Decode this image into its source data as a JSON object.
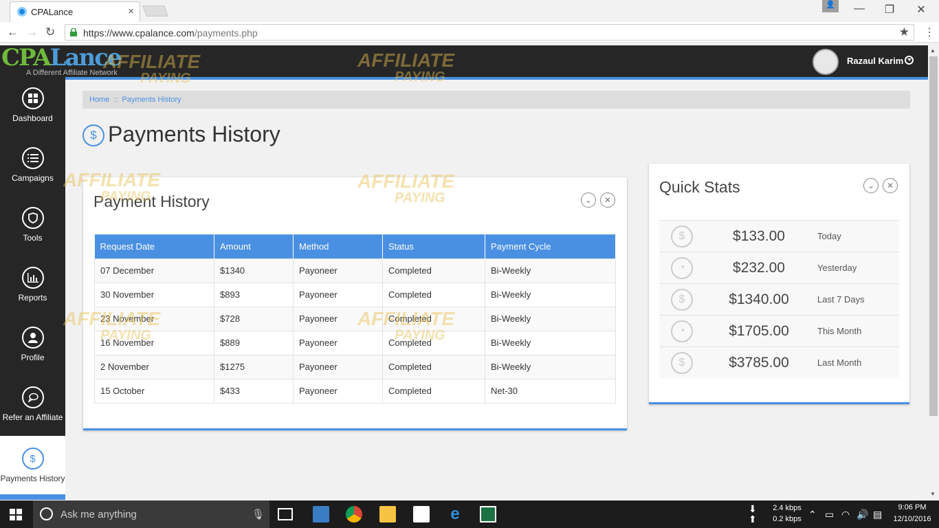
{
  "browser": {
    "tab_title": "CPALance",
    "tab_close": "×",
    "url_host": "https://www.cpalance.com",
    "url_path": "/payments.php",
    "window_controls": {
      "minimize": "—",
      "restore": "❐",
      "close": "✕"
    },
    "nav": {
      "back": "←",
      "forward": "→",
      "reload": "↻"
    },
    "bookmark_icon": "★",
    "menu_icon": "⋮"
  },
  "site": {
    "logo_part1": "CPA",
    "logo_part2": "Lance",
    "logo_tagline": "A Different Affiliate Network",
    "user_name": "Razaul Karim"
  },
  "watermark": {
    "line1": "AFFILIATE",
    "line2": "PAYING"
  },
  "sidebar": {
    "items": [
      {
        "label": "Dashboard",
        "icon": "grid-icon"
      },
      {
        "label": "Campaigns",
        "icon": "list-icon"
      },
      {
        "label": "Tools",
        "icon": "shield-icon"
      },
      {
        "label": "Reports",
        "icon": "bar-chart-icon"
      },
      {
        "label": "Profile",
        "icon": "user-icon"
      },
      {
        "label": "Refer an Affiliate",
        "icon": "chat-icon"
      }
    ],
    "active": {
      "label": "Payments History",
      "icon": "dollar-icon",
      "glyph": "$"
    }
  },
  "breadcrumb": {
    "home": "Home",
    "separator": "::",
    "current": "Payments History"
  },
  "page": {
    "title": "Payments History",
    "icon_glyph": "$"
  },
  "history_panel": {
    "title": "Payment History",
    "columns": [
      "Request Date",
      "Amount",
      "Method",
      "Status",
      "Payment Cycle"
    ],
    "rows": [
      [
        "07 December",
        "$1340",
        "Payoneer",
        "Completed",
        "Bi-Weekly"
      ],
      [
        "30 November",
        "$893",
        "Payoneer",
        "Completed",
        "Bi-Weekly"
      ],
      [
        "23 November",
        "$728",
        "Payoneer",
        "Completed",
        "Bi-Weekly"
      ],
      [
        "16 November",
        "$889",
        "Payoneer",
        "Completed",
        "Bi-Weekly"
      ],
      [
        "2 November",
        "$1275",
        "Payoneer",
        "Completed",
        "Bi-Weekly"
      ],
      [
        "15 October",
        "$433",
        "Payoneer",
        "Completed",
        "Net-30"
      ]
    ]
  },
  "quick_stats": {
    "title": "Quick Stats",
    "rows": [
      {
        "value": "$133.00",
        "label": "Today",
        "icon": "dollar-icon"
      },
      {
        "value": "$232.00",
        "label": "Yesterday",
        "icon": "piggy-bank-icon"
      },
      {
        "value": "$1340.00",
        "label": "Last 7 Days",
        "icon": "dollar-icon"
      },
      {
        "value": "$1705.00",
        "label": "This Month",
        "icon": "piggy-bank-icon"
      },
      {
        "value": "$3785.00",
        "label": "Last Month",
        "icon": "dollar-icon"
      }
    ]
  },
  "panel_controls": {
    "collapse": "⌄",
    "close": "✕"
  },
  "taskbar": {
    "search_placeholder": "Ask me anything",
    "net_down": "2.4 kbps",
    "net_up": "0.2 kbps",
    "time": "9:06 PM",
    "date": "12/10/2016"
  },
  "colors": {
    "accent": "#4a90e2",
    "dark": "#262626",
    "logo_green": "#6fba3c",
    "logo_blue": "#4c9bd8"
  }
}
